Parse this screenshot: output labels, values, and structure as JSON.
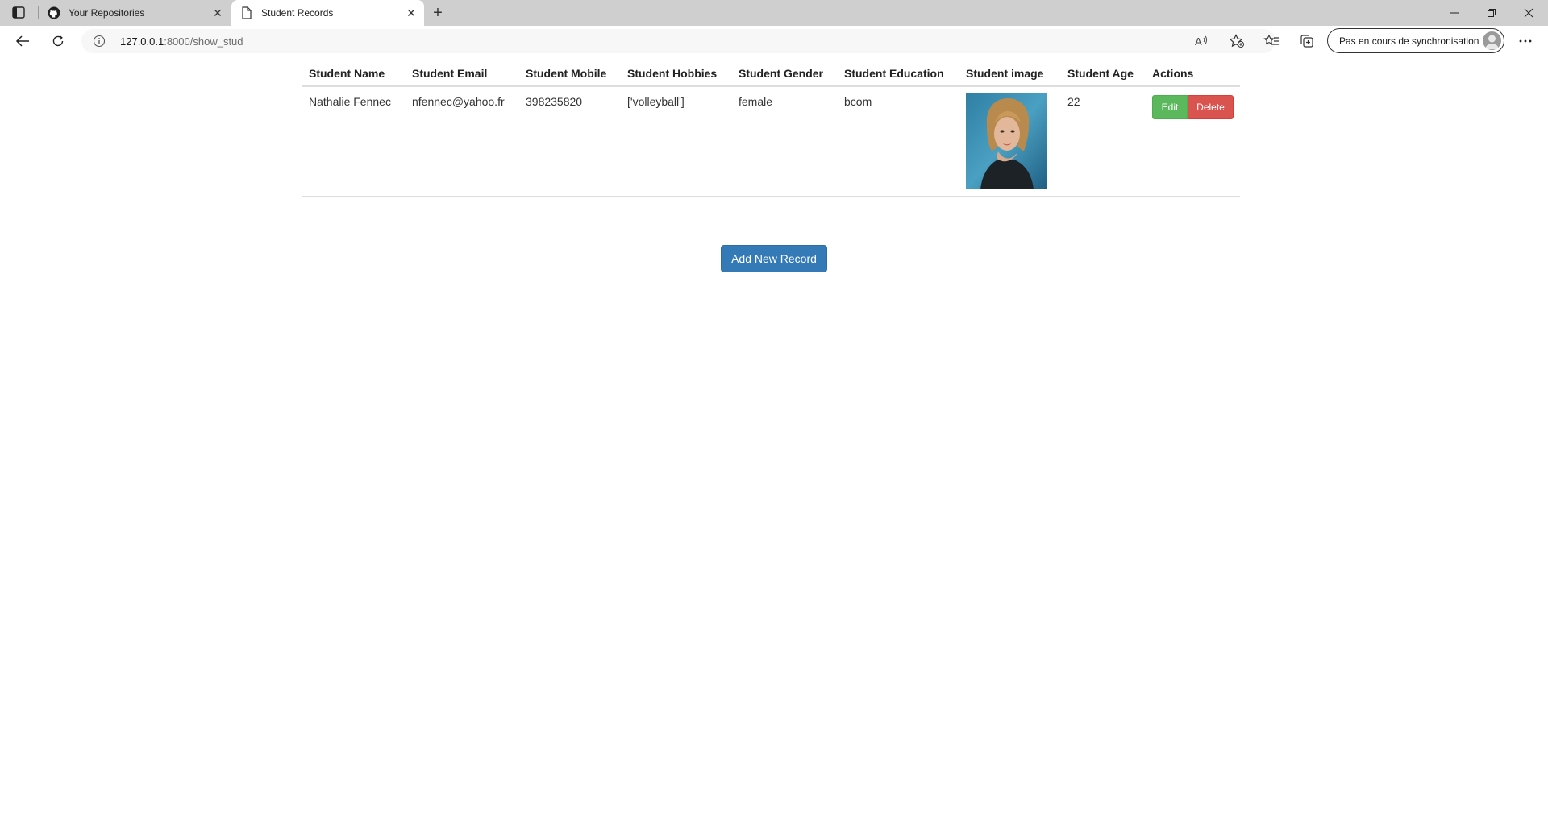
{
  "tabs": [
    {
      "title": "Your Repositories",
      "favicon": "github-icon"
    },
    {
      "title": "Student Records",
      "favicon": "page-icon"
    }
  ],
  "address_bar": {
    "host": "127.0.0.1",
    "rest": ":8000/show_stud"
  },
  "profile": {
    "label": "Pas en cours de synchronisation"
  },
  "table": {
    "headers": [
      "Student Name",
      "Student Email",
      "Student Mobile",
      "Student Hobbies",
      "Student Gender",
      "Student Education",
      "Student image",
      "Student Age",
      "Actions"
    ],
    "rows": [
      {
        "name": "Nathalie Fennec",
        "email": "nfennec@yahoo.fr",
        "mobile": "398235820",
        "hobbies": "['volleyball']",
        "gender": "female",
        "education": "bcom",
        "age": "22",
        "edit_label": "Edit",
        "delete_label": "Delete"
      }
    ]
  },
  "add_button": {
    "label": "Add New Record"
  },
  "colors": {
    "edit": "#5cb85c",
    "delete": "#d9534f",
    "primary": "#337ab7"
  }
}
